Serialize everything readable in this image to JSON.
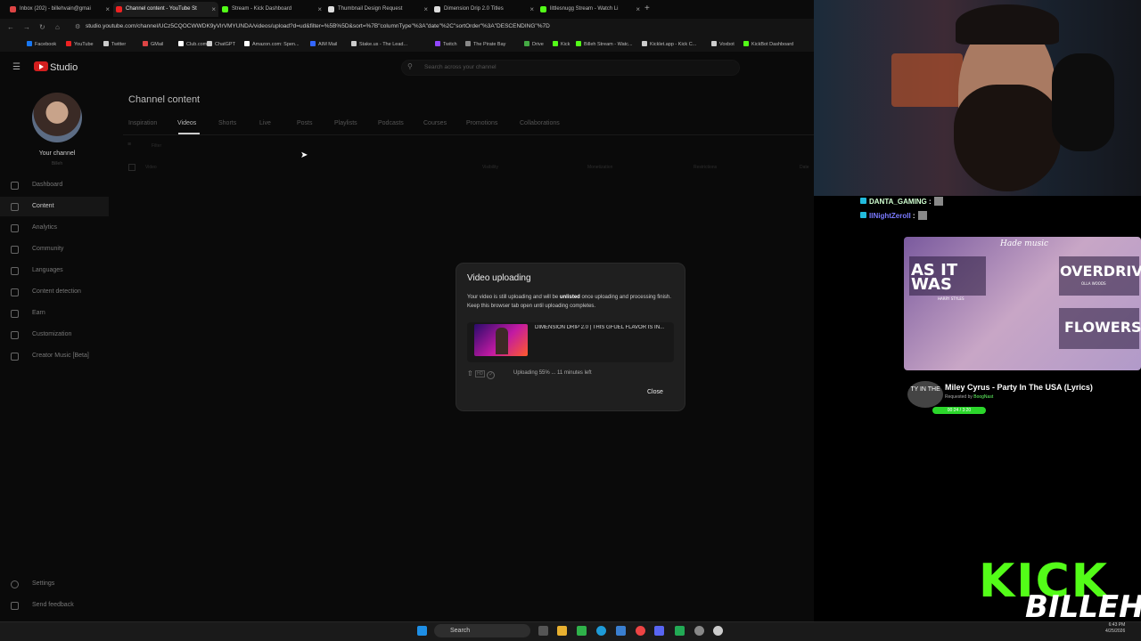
{
  "tabs": [
    {
      "label": "Inbox (202) - billehvain@gmai",
      "color": "#d44"
    },
    {
      "label": "Channel content - YouTube St",
      "color": "#e22",
      "active": true
    },
    {
      "label": "Stream - Kick Dashboard",
      "color": "#53fc18"
    },
    {
      "label": "Thumbnail Design Request",
      "color": "#ddd"
    },
    {
      "label": "Dimension Drip 2.0 Titles",
      "color": "#ddd"
    },
    {
      "label": "littlesnugg Stream - Watch Li",
      "color": "#53fc18"
    }
  ],
  "address": {
    "url": "studio.youtube.com/channel/UCz5CQOCWWDK9yVlrVMYUNDA/videos/upload?d=ud&filter=%5B%5D&sort=%7B\"columnType\"%3A\"date\"%2C\"sortOrder\"%3A\"DESCENDING\"%7D"
  },
  "bookmarks": [
    "Facebook",
    "YouTube",
    "Twitter",
    "GMail",
    "Club.com",
    "ChatGPT",
    "Amazon.com: Spen...",
    "AIM Mail",
    "Stake.us - The Lead...",
    "Twitch",
    "The Pirate Bay",
    "Drive",
    "Kick",
    "Billeh Stream - Watc...",
    "Kicklet.app - Kick C...",
    "Voxbot",
    "KickBot Dashboard"
  ],
  "studio": {
    "logo": "Studio",
    "search_placeholder": "Search across your channel",
    "channel_label": "Your channel",
    "channel_sub": "Billeh",
    "page_title": "Channel content"
  },
  "sidebar": [
    {
      "label": "Dashboard"
    },
    {
      "label": "Content",
      "selected": true
    },
    {
      "label": "Analytics"
    },
    {
      "label": "Community"
    },
    {
      "label": "Languages"
    },
    {
      "label": "Content detection"
    },
    {
      "label": "Earn"
    },
    {
      "label": "Customization"
    },
    {
      "label": "Creator Music [Beta]"
    }
  ],
  "sidebar_bottom": {
    "settings": "Settings",
    "feedback": "Send feedback"
  },
  "content_tabs": [
    "Inspiration",
    "Videos",
    "Shorts",
    "Live",
    "Posts",
    "Playlists",
    "Podcasts",
    "Courses",
    "Promotions",
    "Collaborations"
  ],
  "table": {
    "filter": "Filter",
    "columns": [
      "Video",
      "Visibility",
      "Monetization",
      "Restrictions",
      "Date"
    ]
  },
  "dialog": {
    "title": "Video uploading",
    "msg_pre": "Your video is still uploading and will be ",
    "msg_bold": "unlisted",
    "msg_post": " once uploading and processing finish. Keep this browser tab open until uploading completes.",
    "video_title": "DIMENSION DRIP 2.0 | THIS GFUEL FLAVOR IS IN...",
    "hd_badge": "HD",
    "status": "Uploading 55% ... 11 minutes left",
    "progress": 0.55,
    "close": "Close"
  },
  "overlay": {
    "chat": [
      {
        "user": "DANTA_GAMING",
        "color": "#d0ffd0"
      },
      {
        "user": "IINightZeroII",
        "color": "#7a7aff"
      }
    ],
    "music_header": "Hade music",
    "albums": [
      "AS IT WAS",
      "OVERDRIVE",
      "FLOWERS"
    ],
    "album_subs": [
      "HARRY STYLES",
      "OLLA WOODS"
    ],
    "now_playing": "Miley Cyrus - Party In The USA (Lyrics)",
    "np_art_text": "TY IN THE",
    "requested_prefix": "Requested by ",
    "requested_by": "BoogNast",
    "np_time": "00:24 / 3:20",
    "kick": "KICK",
    "billeh": "BILLEH"
  },
  "taskbar": {
    "search": "Search",
    "time": "6:43 PM",
    "date": "4/25/2026"
  }
}
